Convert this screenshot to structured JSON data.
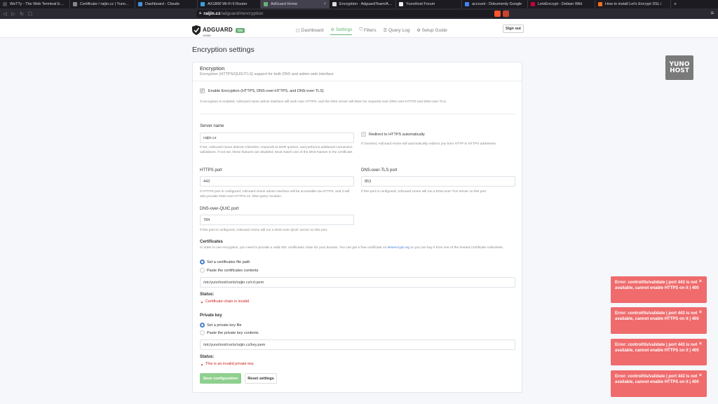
{
  "browser": {
    "tabs": [
      {
        "title": "WeTTy - The Web Terminal Emula",
        "color": "#4a4a4a",
        "active": false
      },
      {
        "title": "Certificate / raijin.cz | YunoHost",
        "color": "#888888",
        "active": false
      },
      {
        "title": "Dashboard - Clouds",
        "color": "#4a90d9",
        "active": false
      },
      {
        "title": "AX1800 Wi-Fi 6 Router",
        "color": "#3aa1d8",
        "active": false
      },
      {
        "title": "AdGuard Home",
        "color": "#67b279",
        "active": true
      },
      {
        "title": "Encryption · AdguardTeam/AdGu",
        "color": "#dddddd",
        "active": false
      },
      {
        "title": "YunoHost Forum",
        "color": "#eeeeee",
        "active": false
      },
      {
        "title": "account - Dokumenty Google",
        "color": "#4285f4",
        "active": false
      },
      {
        "title": "LetsEncrypt - Debian Wiki",
        "color": "#c70036",
        "active": false
      },
      {
        "title": "How to install Let's Encrypt SSL i",
        "color": "#f2711c",
        "active": false
      }
    ],
    "url_host": "raijin.cz",
    "url_path": "/adguard/#encryption"
  },
  "header": {
    "brand_name": "ADGUARD",
    "brand_sub": "HOME",
    "status_badge": "ON",
    "nav": [
      {
        "label": "Dashboard",
        "icon": "dashboard-icon",
        "active": false
      },
      {
        "label": "Settings",
        "icon": "settings-icon",
        "active": true
      },
      {
        "label": "Filters",
        "icon": "filter-icon",
        "active": false
      },
      {
        "label": "Query Log",
        "icon": "query-log-icon",
        "active": false
      },
      {
        "label": "Setup Guide",
        "icon": "setup-guide-icon",
        "active": false
      }
    ],
    "sign_out": "Sign out"
  },
  "page_title": "Encryption settings",
  "card": {
    "title": "Encryption",
    "subtitle": "Encryption (HTTPS/QUIC/TLS) support for both DNS and admin web interface",
    "enable_label": "Enable Encryption (HTTPS, DNS-over-HTTPS, and DNS-over-TLS)",
    "enable_hint": "If encryption is enabled, AdGuard Home admin interface will work over HTTPS, and the DNS server will listen for requests over DNS-over-HTTPS and DNS-over-TLS.",
    "server_name_label": "Server name",
    "server_name_value": "raijin.cz",
    "server_name_hint": "If set, AdGuard Home detects ClientIDs, responds to DDR queries, and performs additional connection validations. If not set, these features are disabled. Must match one of the DNS Names in the certificate.",
    "redirect_label": "Redirect to HTTPS automatically",
    "redirect_hint": "If checked, AdGuard Home will automatically redirect you from HTTP to HTTPS addresses.",
    "https_port_label": "HTTPS port",
    "https_port_value": "443",
    "https_port_hint": "If HTTPS port is configured, AdGuard Home admin interface will be accessible via HTTPS, and it will also provide DNS-over-HTTPS on '/dns-query' location.",
    "dot_port_label": "DNS-over-TLS port",
    "dot_port_value": "853",
    "dot_port_hint": "If this port is configured, AdGuard Home will run a DNS-over-TLS server on this port.",
    "doq_port_label": "DNS-over-QUIC port",
    "doq_port_value": "784",
    "doq_port_hint": "If this port is configured, AdGuard Home will run a DNS-over-QUIC server on this port.",
    "certificates_label": "Certificates",
    "certificates_hint_pre": "In order to use encryption, you need to provide a valid SSL certificates chain for your domain. You can get a free certificate on ",
    "certificates_link": "letsencrypt.org",
    "certificates_hint_post": " or you can buy it from one of the trusted Certificate Authorities.",
    "cert_option_path": "Set a certificates file path",
    "cert_option_paste": "Paste the certificates contents",
    "cert_path_value": "/etc/yunohost/certs/raijin.cz/crt.pem",
    "status_label": "Status:",
    "cert_status": "Certificate chain is invalid",
    "private_key_label": "Private key",
    "key_option_path": "Set a private key file",
    "key_option_paste": "Paste the private key contents",
    "key_path_value": "/etc/yunohost/certs/raijin.cz/key.pem",
    "key_status_label": "Status:",
    "key_status": "This is an invalid private key",
    "save_button": "Save configuration",
    "reset_button": "Reset settings"
  },
  "toasts": [
    {
      "message": "Error: control/tls/validate | port 443 is not available, cannot enable HTTPS on it | 400"
    },
    {
      "message": "Error: control/tls/validate | port 443 is not available, cannot enable HTTPS on it | 400"
    },
    {
      "message": "Error: control/tls/validate | port 443 is not available, cannot enable HTTPS on it | 400"
    },
    {
      "message": "Error: control/tls/validate | port 443 is not available, cannot enable HTTPS on it | 400"
    }
  ],
  "yunohost_logo": "YUNO HOST",
  "colors": {
    "accent_green": "#67b279",
    "error_red": "#cd201f",
    "toast_red": "#ef6b6c",
    "link_blue": "#467fcf"
  }
}
